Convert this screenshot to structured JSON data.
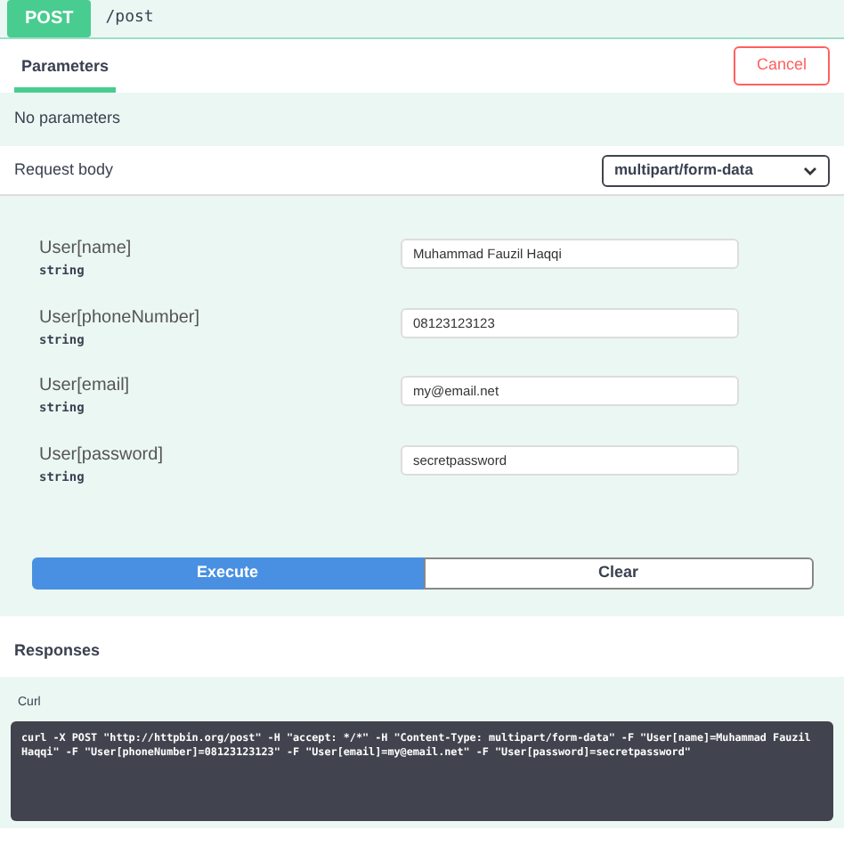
{
  "operation": {
    "method": "POST",
    "path": "/post"
  },
  "tabs": [
    {
      "label": "Parameters",
      "selected": true
    }
  ],
  "cancel_button": "Cancel",
  "parameters_message": "No parameters",
  "request_body": {
    "label": "Request body",
    "content_type": "multipart/form-data"
  },
  "fields": [
    {
      "name": "User[name]",
      "type": "string",
      "value": "Muhammad Fauzil Haqqi"
    },
    {
      "name": "User[phoneNumber]",
      "type": "string",
      "value": "08123123123"
    },
    {
      "name": "User[email]",
      "type": "string",
      "value": "my@email.net"
    },
    {
      "name": "User[password]",
      "type": "string",
      "value": "secretpassword"
    }
  ],
  "buttons": [
    {
      "label": "Execute",
      "kind": "primary"
    },
    {
      "label": "Clear",
      "kind": "secondary"
    }
  ],
  "responses": {
    "title": "Responses",
    "curl_label": "Curl",
    "curl": "curl -X POST \"http://httpbin.org/post\" -H \"accept: */*\" -H \"Content-Type: multipart/form-data\" -F \"User[name]=Muhammad Fauzil Haqqi\" -F \"User[phoneNumber]=08123123123\" -F \"User[email]=my@email.net\" -F \"User[password]=secretpassword\""
  }
}
